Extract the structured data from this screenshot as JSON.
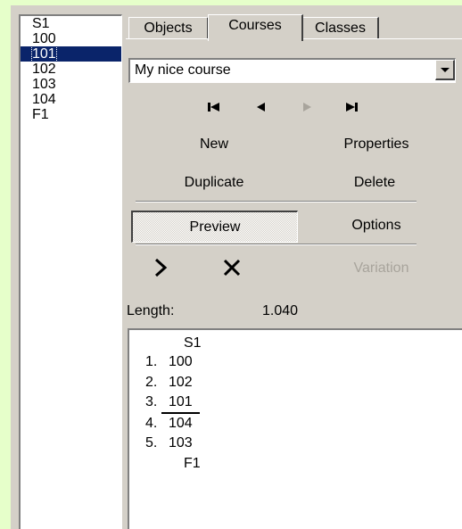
{
  "controls_list": {
    "items": [
      "S1",
      "100",
      "101",
      "102",
      "103",
      "104",
      "F1"
    ],
    "selected_index": 2
  },
  "tabs": [
    {
      "label": "Objects"
    },
    {
      "label": "Courses"
    },
    {
      "label": "Classes"
    }
  ],
  "active_tab": "Courses",
  "course_select": {
    "value": "My nice course"
  },
  "nav": {
    "first": "first-icon",
    "prev": "previous-icon",
    "next": "next-icon",
    "last": "last-icon"
  },
  "commands": {
    "new": "New",
    "properties": "Properties",
    "duplicate": "Duplicate",
    "delete": "Delete",
    "preview": "Preview",
    "options": "Options",
    "variation": "Variation"
  },
  "length": {
    "label": "Length:",
    "value": "1.040"
  },
  "course": {
    "start": "S1",
    "legs": [
      {
        "num": "1.",
        "code": "100"
      },
      {
        "num": "2.",
        "code": "102"
      },
      {
        "num": "3.",
        "code": "101"
      },
      {
        "num": "4.",
        "code": "104"
      },
      {
        "num": "5.",
        "code": "103"
      }
    ],
    "finish": "F1"
  }
}
